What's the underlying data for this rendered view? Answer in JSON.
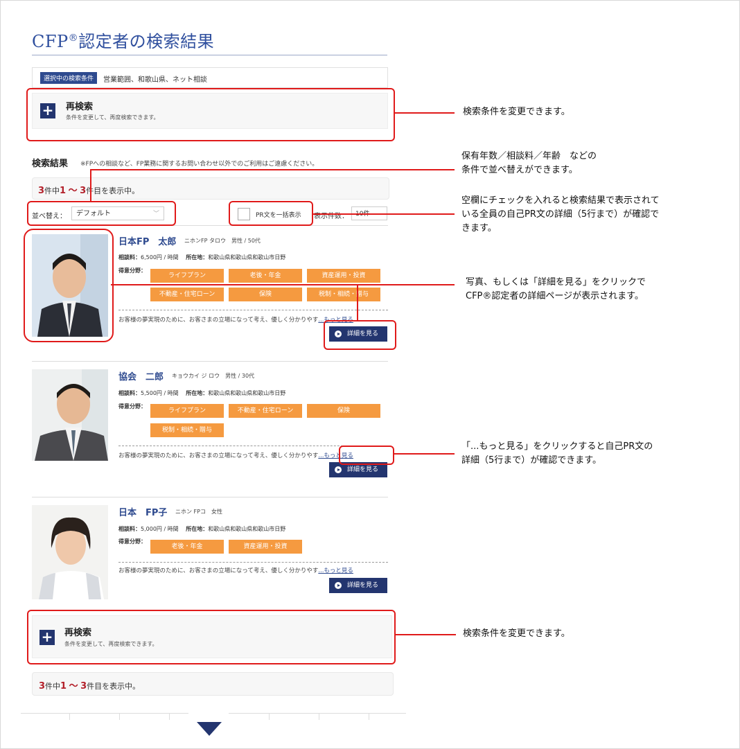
{
  "page": {
    "title_prefix": "CFP",
    "title_sup": "®",
    "title_suffix": "認定者の検索結果"
  },
  "conditions": {
    "label": "選択中の検索条件",
    "value": "営業範囲、和歌山県、ネット相談"
  },
  "research": {
    "title": "再検索",
    "subtitle": "条件を変更して、再度検索できます。",
    "icon": "plus-icon"
  },
  "results": {
    "heading": "検索結果",
    "note": "※FPへの相談など、FP業務に関するお問い合わせ以外でのご利用はご遠慮ください。",
    "count": {
      "total": "3",
      "total_unit": "件中",
      "from": "1",
      "range_sep": "～",
      "to": "3",
      "suffix": "件目を表示中。"
    },
    "sort_label": "並べ替え：",
    "sort_value": "デフォルト",
    "pr_toggle_label": "PR文を一括表示",
    "display_label": "表示件数：",
    "display_value": "10件",
    "fee_label": "相談料：",
    "location_label": "所在地：",
    "specialty_label": "得意分野：",
    "detail_button": "詳細を見る",
    "more_link": "...もっと見る"
  },
  "people": [
    {
      "name": "日本FP　太郎",
      "kana": "ニホンFP タロウ",
      "profile": "男性 / 50代",
      "fee": "6,500円 / 時間",
      "location": "和歌山県和歌山県和歌山市日野",
      "tags": [
        "ライフプラン",
        "老後・年金",
        "資産運用・投資",
        "不動産・住宅ローン",
        "保険",
        "税制・相続・贈与"
      ],
      "pr": "お客様の夢実現のために、お客さまの立場になって考え、優しく分かりやす"
    },
    {
      "name": "協会　二郎",
      "kana": "キョウカイ ジ ロウ",
      "profile": "男性 / 30代",
      "fee": "5,500円 / 時間",
      "location": "和歌山県和歌山県和歌山市日野",
      "tags": [
        "ライフプラン",
        "不動産・住宅ローン",
        "保険",
        "税制・相続・贈与"
      ],
      "pr": "お客様の夢実現のために、お客さまの立場になって考え、優しく分かりやす"
    },
    {
      "name": "日本　FP子",
      "kana": "ニホン FPコ",
      "profile": "女性",
      "fee": "5,000円 / 時間",
      "location": "和歌山県和歌山県和歌山市日野",
      "tags": [
        "老後・年金",
        "資産運用・投資"
      ],
      "pr": "お客様の夢実現のために、お客さまの立場になって考え、優しく分かりやす"
    }
  ],
  "annotations": {
    "research_top": "検索条件を変更できます。",
    "sort_1": "保有年数／相談料／年齢　などの",
    "sort_2": "条件で並べ替えができます。",
    "pr_1": "空欄にチェックを入れると検索結果で表示されて",
    "pr_2": "いる全員の自己PR文の詳細（5行まで）が確認で",
    "pr_3": "きます。",
    "photo_1": "写真、もしくは「詳細を見る」をクリックで",
    "photo_2": "CFP®認定者の詳細ページが表示されます。",
    "more_1": "「...もっと見る」をクリックすると自己PR文の",
    "more_2": "詳細（5行まで）が確認できます。",
    "research_bottom": "検索条件を変更できます。"
  },
  "colors": {
    "brand_navy": "#23356f",
    "tag_orange": "#f59a40",
    "annotation_red": "#e01a1a",
    "count_red": "#b3202a"
  }
}
